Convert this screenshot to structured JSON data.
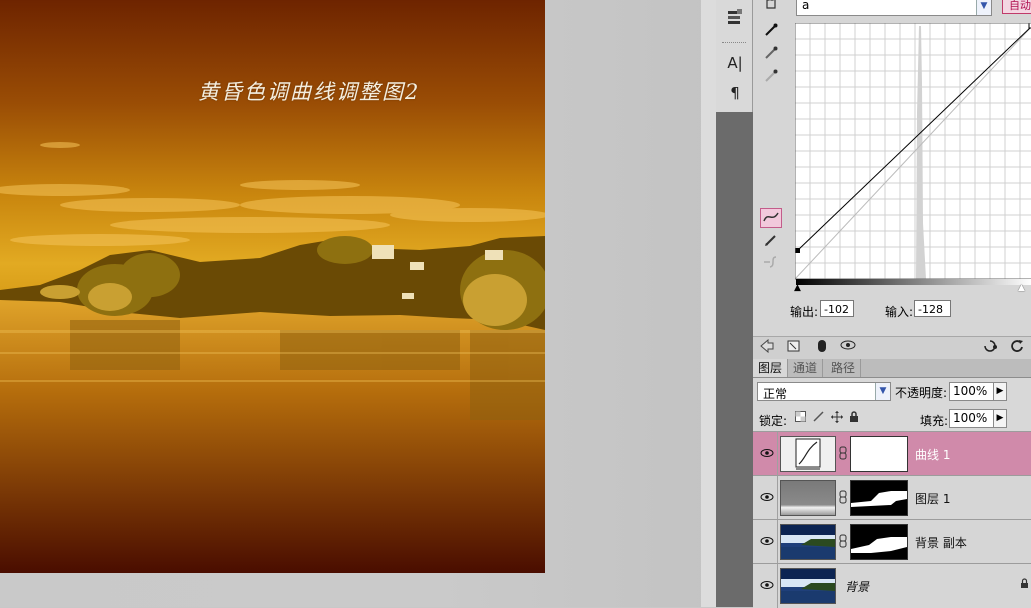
{
  "photo": {
    "caption": "黄昏色调曲线调整图2"
  },
  "tools": {
    "icons": [
      "text-adjust-icon",
      "character-panel-icon",
      "paragraph-icon"
    ],
    "char_label": "A|",
    "para_label": "¶"
  },
  "curves": {
    "channel": "a",
    "auto_label": "自动",
    "output_label": "输出:",
    "output_value": "-102",
    "input_label": "输入:",
    "input_value": "-128"
  },
  "layers_panel": {
    "tabs": [
      "图层",
      "通道",
      "路径"
    ],
    "blend_mode": "正常",
    "opacity_label": "不透明度:",
    "opacity_value": "100%",
    "lock_label": "锁定:",
    "fill_label": "填充:",
    "fill_value": "100%",
    "layers": [
      {
        "name": "曲线 1",
        "selected": true
      },
      {
        "name": "图层 1",
        "selected": false
      },
      {
        "name": "背景 副本",
        "selected": false
      },
      {
        "name": "背景",
        "selected": false
      }
    ]
  }
}
